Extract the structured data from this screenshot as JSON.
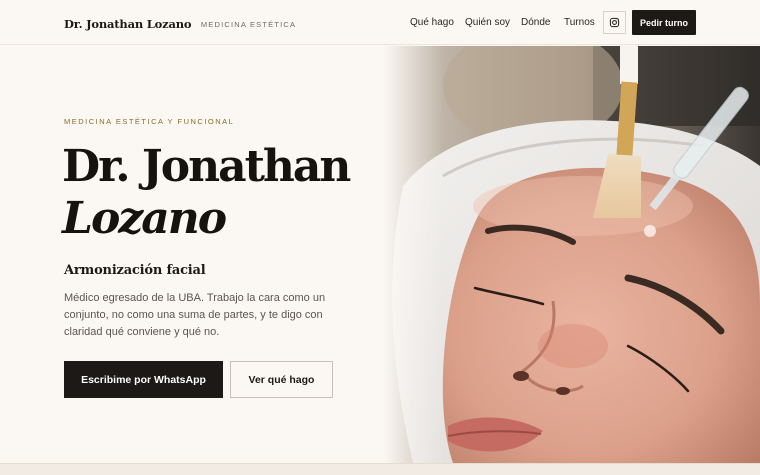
{
  "header": {
    "brand_name": "Dr. Jonathan Lozano",
    "brand_tagline": "MEDICINA ESTÉTICA",
    "nav": [
      {
        "label": "Qué hago"
      },
      {
        "label": "Quién soy"
      },
      {
        "label": "Dónde"
      },
      {
        "label": "Turnos"
      }
    ],
    "instagram_icon": "instagram-icon",
    "cta_label": "Pedir turno"
  },
  "hero": {
    "eyebrow": "MEDICINA ESTÉTICA Y FUNCIONAL",
    "title_line1": "Dr. Jonathan",
    "title_line2": "Lozano",
    "subtitle": "Armonización facial",
    "description": "Médico egresado de la UBA. Trabajo la cara como un conjunto, no como una suma de partes, y te digo con claridad qué conviene y qué no.",
    "primary_button": "Escribime por WhatsApp",
    "secondary_button": "Ver qué hago"
  },
  "colors": {
    "background": "#fbf8f4",
    "ink": "#1c1917",
    "accent_gold": "#8a6a2d",
    "muted_text": "#5c554f"
  }
}
